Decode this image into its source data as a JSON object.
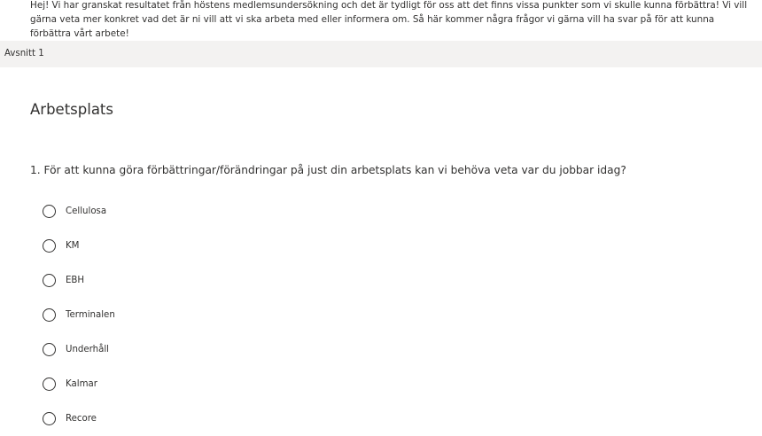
{
  "intro": {
    "text": "Hej! Vi har granskat resultatet från höstens medlemsundersökning och det är tydligt för oss att det finns vissa punkter som vi skulle kunna förbättra! Vi vill gärna veta mer konkret vad det är ni vill att vi ska arbeta med eller informera om. Så här kommer några frågor vi gärna vill ha svar på för att kunna förbättra vårt arbete!"
  },
  "section": {
    "label": "Avsnitt 1",
    "title": "Arbetsplats"
  },
  "question": {
    "text": "1. För att kunna göra förbättringar/förändringar på just din arbetsplats kan vi behöva veta var du jobbar idag?",
    "options": [
      {
        "label": "Cellulosa"
      },
      {
        "label": "KM"
      },
      {
        "label": "EBH"
      },
      {
        "label": "Terminalen"
      },
      {
        "label": "Underhåll"
      },
      {
        "label": "Kalmar"
      },
      {
        "label": "Recore"
      }
    ]
  }
}
